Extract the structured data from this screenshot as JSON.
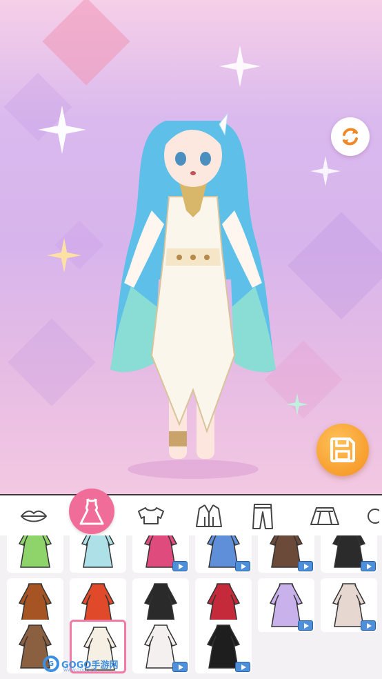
{
  "screen": {
    "buttons": {
      "refresh_icon": "refresh-icon",
      "save_icon": "floppy-disk-icon"
    }
  },
  "tabs": [
    {
      "name": "tab-lips",
      "icon": "lips-icon"
    },
    {
      "name": "tab-dress",
      "icon": "dress-icon",
      "active": true
    },
    {
      "name": "tab-top",
      "icon": "crop-top-icon"
    },
    {
      "name": "tab-jacket",
      "icon": "jacket-icon"
    },
    {
      "name": "tab-pants",
      "icon": "pants-icon"
    },
    {
      "name": "tab-skirt",
      "icon": "skirt-icon"
    }
  ],
  "items": [
    {
      "row": 0,
      "col": 0,
      "color": "#8fd36b",
      "badge": "none"
    },
    {
      "row": 0,
      "col": 1,
      "color": "#aee0e8",
      "badge": "none"
    },
    {
      "row": 0,
      "col": 2,
      "color": "#e04b7d",
      "badge": "video"
    },
    {
      "row": 0,
      "col": 3,
      "color": "#5f8fd8",
      "badge": "video"
    },
    {
      "row": 0,
      "col": 4,
      "color": "#6b4a3a",
      "badge": "video"
    },
    {
      "row": 0,
      "col": 5,
      "color": "#2b2b2b",
      "badge": "video"
    },
    {
      "row": 1,
      "col": 0,
      "color": "#a65424",
      "badge": "gem"
    },
    {
      "row": 1,
      "col": 1,
      "color": "#e04a2a",
      "badge": "gem"
    },
    {
      "row": 1,
      "col": 2,
      "color": "#2a2a2a",
      "badge": "video"
    },
    {
      "row": 1,
      "col": 3,
      "color": "#c42a3a",
      "badge": "video"
    },
    {
      "row": 1,
      "col": 4,
      "color": "#c9b2ec",
      "badge": "video"
    },
    {
      "row": 1,
      "col": 5,
      "color": "#e6d8d0",
      "badge": "video"
    },
    {
      "row": 2,
      "col": 0,
      "color": "#8b6040",
      "badge": "none"
    },
    {
      "row": 2,
      "col": 1,
      "color": "#f6efe4",
      "badge": "none",
      "selected": true
    },
    {
      "row": 2,
      "col": 2,
      "color": "#f4f0f0",
      "badge": "video"
    },
    {
      "row": 2,
      "col": 3,
      "color": "#1e1e1e",
      "badge": "video"
    }
  ],
  "watermark": {
    "brand": "GOGO手游网",
    "url": "WWW.GOGO.CN",
    "logo": "G"
  },
  "colors": {
    "accent": "#f06d9a",
    "save": "#f4901c",
    "video": "#4d8fd8"
  }
}
